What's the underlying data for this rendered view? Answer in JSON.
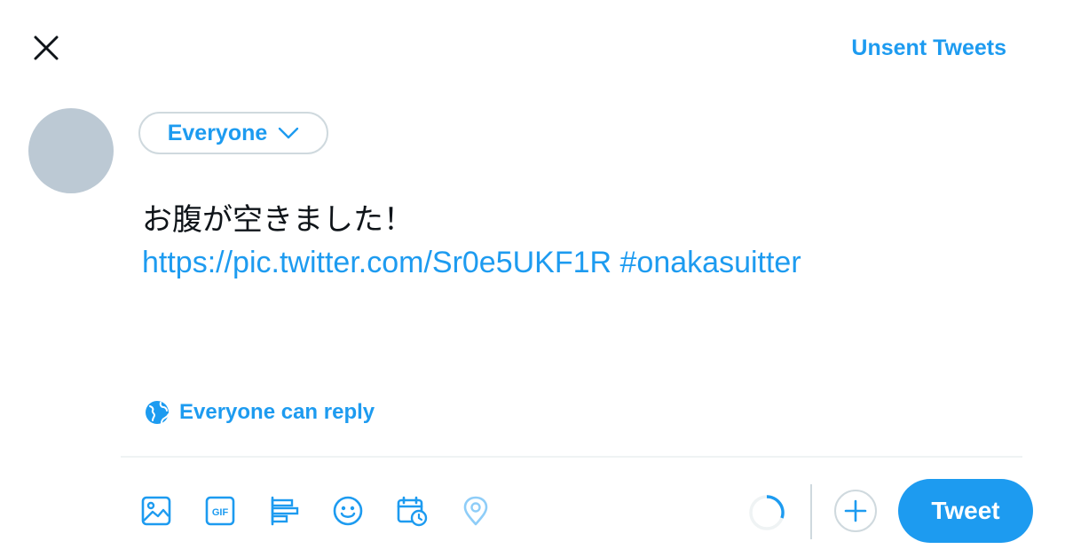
{
  "header": {
    "close_icon": "close-icon",
    "unsent_label": "Unsent Tweets"
  },
  "audience": {
    "label": "Everyone",
    "icon": "chevron-down-icon"
  },
  "compose": {
    "text_line1": "お腹が空きました！",
    "text_line2": "https://pic.twitter.com/Sr0e5UKF1R #onakasuitter"
  },
  "reply_setting": {
    "icon": "globe-icon",
    "label": "Everyone can reply"
  },
  "toolbar": {
    "tools": [
      "image-icon",
      "gif-icon",
      "poll-icon",
      "emoji-icon",
      "schedule-icon",
      "location-icon"
    ],
    "tweet_label": "Tweet",
    "add_icon": "plus-icon"
  },
  "colors": {
    "accent": "#1d9bf0",
    "text": "#0f1419",
    "border": "#cfd9de",
    "avatar": "#bcc9d4"
  }
}
